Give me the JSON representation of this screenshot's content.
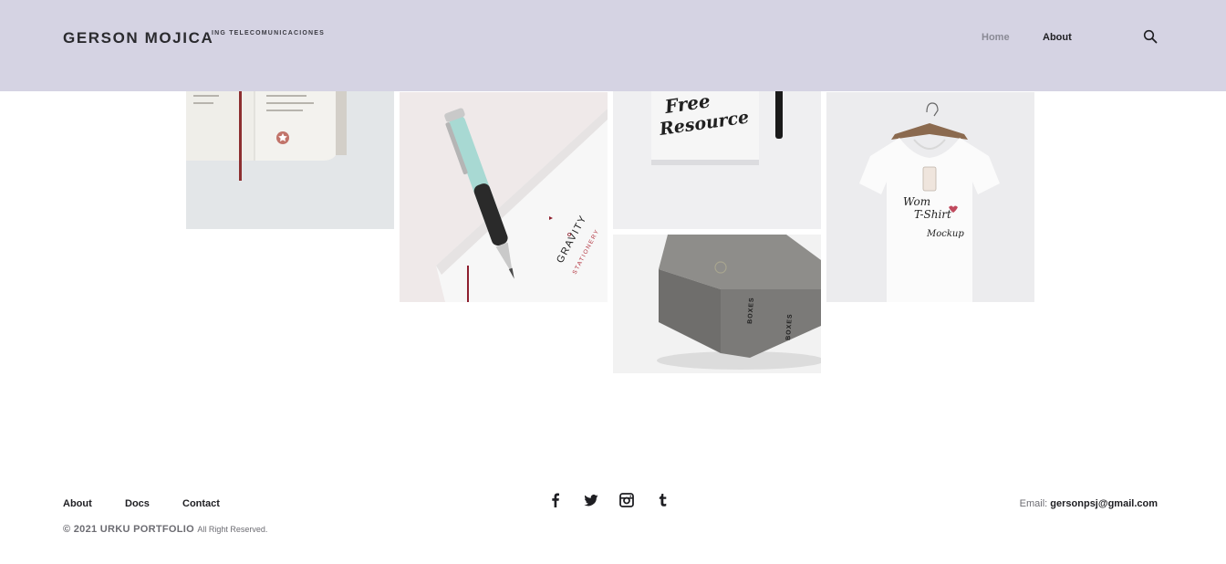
{
  "header": {
    "brand": "GERSON MOJICA",
    "tagline": "ING TELECOMUNICACIONES",
    "nav": {
      "home": "Home",
      "about": "About"
    },
    "search_icon": "search-icon"
  },
  "gallery": {
    "tiles": [
      {
        "name": "notebook-mockup"
      },
      {
        "name": "pen-stationery-mockup",
        "text": {
          "brand": "GRAVITY",
          "sub": "STATIONERY"
        }
      },
      {
        "name": "free-resource-mockup",
        "text": {
          "line1": "Free",
          "line2": "Resource"
        }
      },
      {
        "name": "box-mockup",
        "text": {
          "label": "BOXES"
        }
      },
      {
        "name": "tshirt-mockup",
        "text": {
          "line1": "Wom",
          "line2": "T-Shirt",
          "line3": "Mockup"
        }
      }
    ]
  },
  "footer": {
    "links": {
      "about": "About",
      "docs": "Docs",
      "contact": "Contact"
    },
    "copyright": "© 2021 URKU PORTFOLIO",
    "rights": "All Right Reserved.",
    "social": [
      "facebook-icon",
      "twitter-icon",
      "instagram-icon",
      "tumblr-icon"
    ],
    "email_label": "Email:",
    "email_value": "gersonpsj@gmail.com"
  },
  "colors": {
    "header_bg": "#d5d3e3",
    "text_dark": "#1e1e22",
    "text_muted": "#8a8a95"
  }
}
